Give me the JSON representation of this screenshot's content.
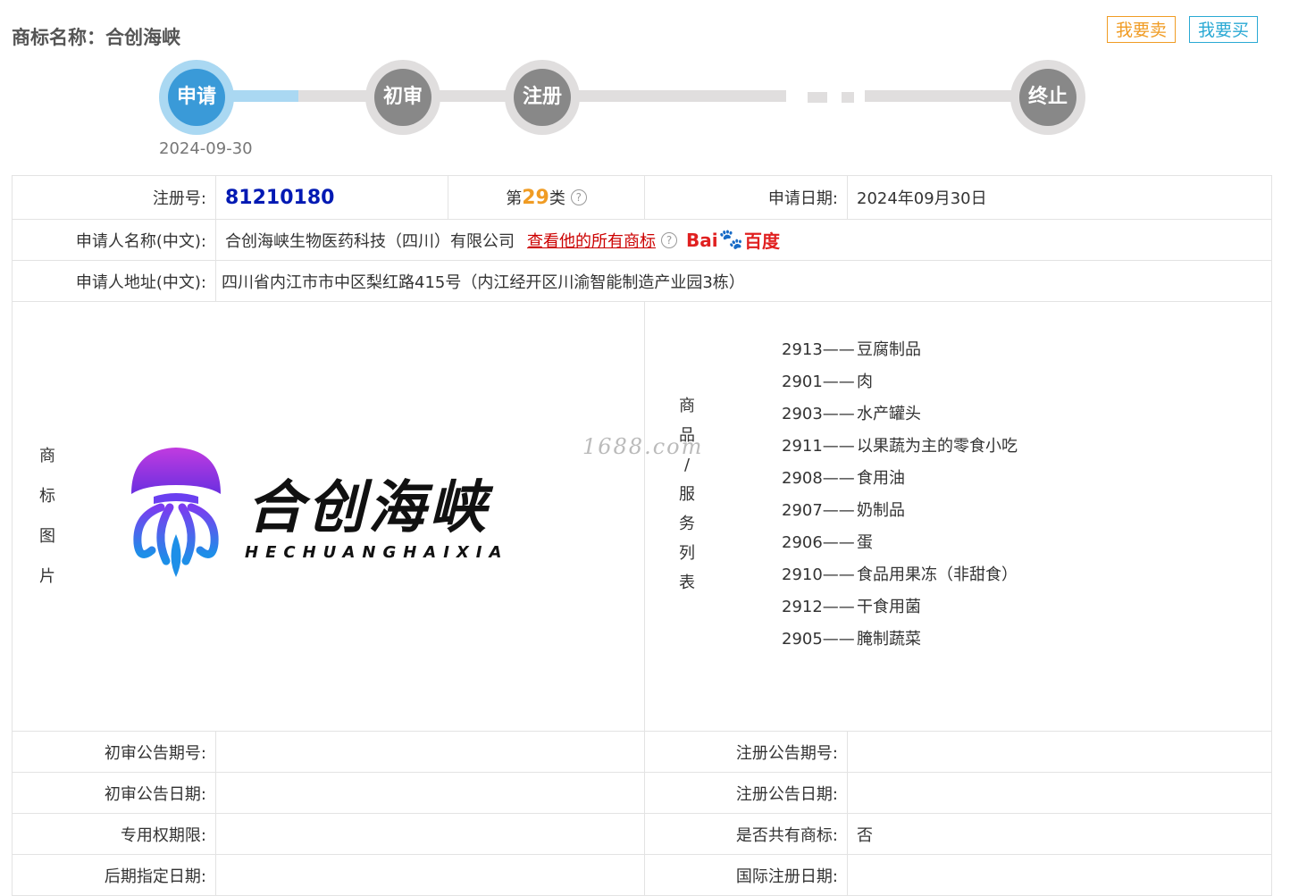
{
  "header": {
    "title": "商标名称：合创海峡",
    "sell_label": "我要卖",
    "buy_label": "我要买"
  },
  "progress": {
    "steps": [
      {
        "label": "申请",
        "active": true,
        "date": "2024-09-30"
      },
      {
        "label": "初审",
        "active": false
      },
      {
        "label": "注册",
        "active": false
      },
      {
        "label": "终止",
        "active": false
      }
    ]
  },
  "info": {
    "reg_no_label": "注册号:",
    "reg_no": "81210180",
    "class_prefix": "第",
    "class_num": "29",
    "class_suffix": "类",
    "apply_date_label": "申请日期:",
    "apply_date": "2024年09月30日",
    "applicant_label": "申请人名称(中文):",
    "applicant": "合创海峡生物医药科技（四川）有限公司",
    "view_all_link": "查看他的所有商标",
    "baidu_a": "Bai",
    "baidu_b": "百度",
    "address_label": "申请人地址(中文):",
    "address": "四川省内江市市中区梨红路415号（内江经开区川渝智能制造产业园3栋）"
  },
  "image_section": {
    "label_chars": [
      "商",
      "标",
      "图",
      "片"
    ],
    "logo_cn": "合创海峡",
    "logo_en": "HECHUANGHAIXIA"
  },
  "goods_section": {
    "label_chars": [
      "商",
      "品",
      "/",
      "服",
      "务",
      "列",
      "表"
    ],
    "watermark": "1688.com",
    "items": [
      {
        "code": "2913——",
        "name": "豆腐制品"
      },
      {
        "code": "2901——",
        "name": "肉"
      },
      {
        "code": "2903——",
        "name": "水产罐头"
      },
      {
        "code": "2911——",
        "name": "以果蔬为主的零食小吃"
      },
      {
        "code": "2908——",
        "name": "食用油"
      },
      {
        "code": "2907——",
        "name": "奶制品"
      },
      {
        "code": "2906——",
        "name": "蛋"
      },
      {
        "code": "2910——",
        "name": "食品用果冻（非甜食）"
      },
      {
        "code": "2912——",
        "name": "干食用菌"
      },
      {
        "code": "2905——",
        "name": "腌制蔬菜"
      }
    ]
  },
  "bottom": {
    "prelim_no_label": "初审公告期号:",
    "reg_no_ann_label": "注册公告期号:",
    "prelim_date_label": "初审公告日期:",
    "reg_date_label": "注册公告日期:",
    "exclusive_label": "专用权期限:",
    "shared_label": "是否共有商标:",
    "shared_value": "否",
    "later_label": "后期指定日期:",
    "intl_label": "国际注册日期:"
  }
}
